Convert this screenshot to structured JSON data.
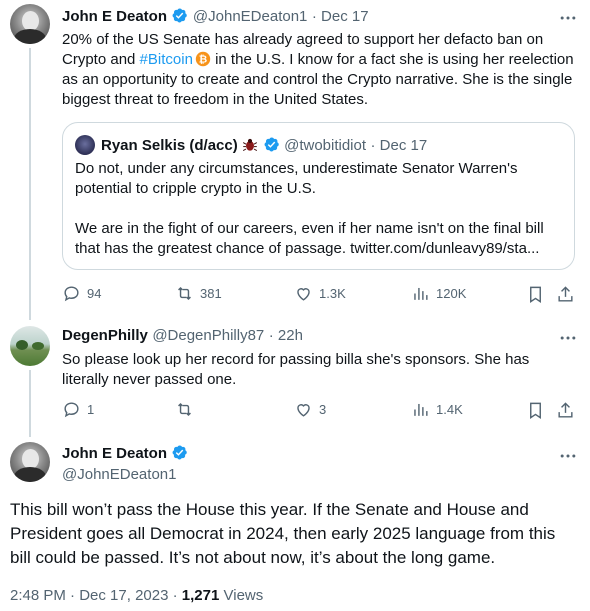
{
  "tweet1": {
    "name": "John E Deaton",
    "handle": "@JohnEDeaton1",
    "date": "Dec 17",
    "text_parts": [
      "20% of the US Senate has already agreed to support her defacto ban on Crypto and ",
      "#Bitcoin",
      " in the U.S. I know for a fact she is using her reelection as an opportunity to create and control the Crypto narrative. She is the single biggest threat to freedom in the United States."
    ],
    "quote": {
      "name": "Ryan Selkis (d/acc)",
      "handle": "@twobitidiot",
      "date": "Dec 17",
      "para1": "Do not, under any circumstances, underestimate Senator Warren's potential to cripple crypto in the U.S.",
      "para2": "We are in the fight of our careers, even if her name isn't on the final bill that has the greatest chance of passage. twitter.com/dunleavy89/sta..."
    },
    "stats": {
      "replies": "94",
      "retweets": "381",
      "likes": "1.3K",
      "views": "120K"
    }
  },
  "tweet2": {
    "name": "DegenPhilly",
    "handle": "@DegenPhilly87",
    "date": "22h",
    "text": "So please look up her record for passing billa she's sponsors. She has literally never passed one.",
    "stats": {
      "replies": "1",
      "retweets": "",
      "likes": "3",
      "views": "1.4K"
    }
  },
  "tweet3": {
    "name": "John E Deaton",
    "handle": "@JohnEDeaton1",
    "text": "This bill won’t pass the House this year. If the Senate and House and President goes all Democrat in 2024, then early 2025 language from this bill could be passed. It’s not about now, it’s about the long game.",
    "time": "2:48 PM",
    "date": "Dec 17, 2023",
    "views_count": "1,271",
    "views_label": "Views"
  },
  "icons": {
    "verified": "verified-badge-icon",
    "bitcoin": "bitcoin-icon",
    "bug": "bug-emoji-icon",
    "reply": "reply-icon",
    "retweet": "retweet-icon",
    "like": "heart-icon",
    "views": "views-chart-icon",
    "bookmark": "bookmark-icon",
    "share": "share-icon",
    "more": "more-dots-icon"
  },
  "colors": {
    "accent": "#1d9bf0",
    "muted": "#536471",
    "text": "#0f1419",
    "border": "#cfd9de",
    "bitcoin": "#f7931a"
  }
}
